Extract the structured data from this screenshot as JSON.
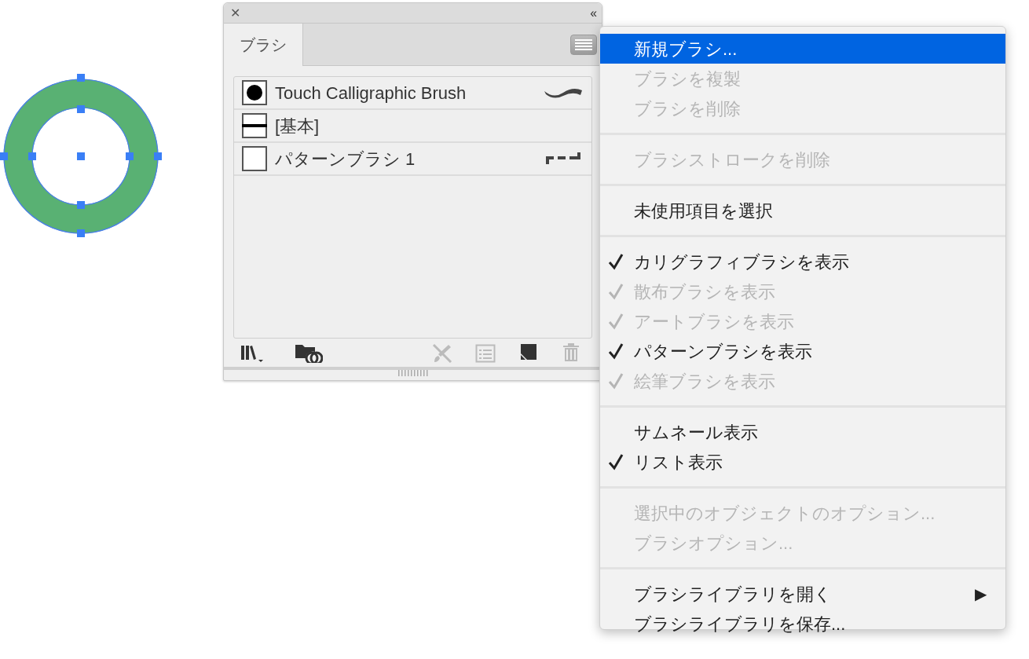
{
  "panel": {
    "close": "✕",
    "collapse": "‹‹",
    "tabs": [
      {
        "label": "ブラシ",
        "selected": true
      }
    ],
    "brushes": [
      {
        "name": "Touch Calligraphic Brush",
        "kind": "dot",
        "preview": {
          "kind": "wave"
        }
      },
      {
        "name": "[基本]",
        "kind": "line"
      },
      {
        "name": "パターンブラシ 1",
        "kind": "blank",
        "preview": {
          "kind": "dashes"
        }
      }
    ],
    "toolbar": [
      {
        "kind": "library",
        "disabled": false
      },
      {
        "kind": "cloud",
        "disabled": false
      },
      {
        "kind": "remove",
        "disabled": true
      },
      {
        "kind": "options",
        "disabled": true
      },
      {
        "kind": "new",
        "disabled": false
      },
      {
        "kind": "trash",
        "disabled": true
      }
    ]
  },
  "menu": {
    "groups": [
      {
        "items": [
          {
            "label": "新規ブラシ...",
            "selected": true,
            "disabled": false,
            "checked": false
          },
          {
            "label": "ブラシを複製",
            "selected": false,
            "disabled": true,
            "checked": false
          },
          {
            "label": "ブラシを削除",
            "selected": false,
            "disabled": true,
            "checked": false
          }
        ]
      },
      {
        "items": [
          {
            "label": "ブラシストロークを削除",
            "selected": false,
            "disabled": true,
            "checked": false
          }
        ]
      },
      {
        "items": [
          {
            "label": "未使用項目を選択",
            "selected": false,
            "disabled": false,
            "checked": false
          }
        ]
      },
      {
        "items": [
          {
            "label": "カリグラフィブラシを表示",
            "selected": false,
            "disabled": false,
            "checked": true
          },
          {
            "label": "散布ブラシを表示",
            "selected": false,
            "disabled": true,
            "checked": true
          },
          {
            "label": "アートブラシを表示",
            "selected": false,
            "disabled": true,
            "checked": true
          },
          {
            "label": "パターンブラシを表示",
            "selected": false,
            "disabled": false,
            "checked": true
          },
          {
            "label": "絵筆ブラシを表示",
            "selected": false,
            "disabled": true,
            "checked": true
          }
        ]
      },
      {
        "items": [
          {
            "label": "サムネール表示",
            "selected": false,
            "disabled": false,
            "checked": false
          },
          {
            "label": "リスト表示",
            "selected": false,
            "disabled": false,
            "checked": true
          }
        ]
      },
      {
        "items": [
          {
            "label": "選択中のオブジェクトのオプション...",
            "selected": false,
            "disabled": true,
            "checked": false
          },
          {
            "label": "ブラシオプション...",
            "selected": false,
            "disabled": true,
            "checked": false
          }
        ]
      },
      {
        "items": [
          {
            "label": "ブラシライブラリを開く",
            "selected": false,
            "disabled": false,
            "checked": false,
            "submenu": "▶"
          },
          {
            "label": "ブラシライブラリを保存...",
            "selected": false,
            "disabled": false,
            "checked": false
          }
        ]
      }
    ]
  }
}
